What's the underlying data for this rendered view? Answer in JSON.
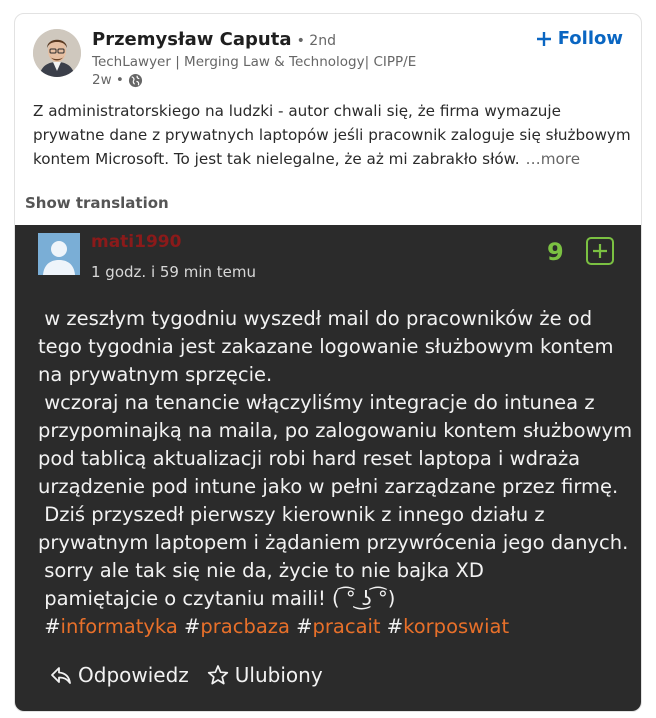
{
  "author": {
    "name": "Przemysław Caputa",
    "degree": "• 2nd",
    "headline": "TechLawyer | Merging Law & Technology| CIPP/E",
    "time": "2w •"
  },
  "follow_label": "Follow",
  "post": {
    "text": "Z administratorskiego na ludzki - autor chwali się, że firma wymazuje prywatne dane z prywatnych laptopów jeśli pracownik zaloguje się służbowym kontem Microsoft. To jest tak nielegalne, że aż mi zabrakło słów.",
    "more": "…more"
  },
  "show_translation": "Show translation",
  "comment": {
    "username": "mati1990",
    "time": "1 godz. i 59 min temu",
    "score": "9",
    "lines": [
      " w zeszłym tygodniu wyszedł mail do pracowników że od",
      "tego tygodnia jest zakazane logowanie służbowym kontem",
      "na prywatnym sprzęcie.",
      " wczoraj na tenancie włączyliśmy integracje do intunea z",
      "przypominajką na maila, po zalogowaniu kontem służbowym",
      "pod tablicą aktualizacji robi hard reset laptopa i wdraża",
      "urządzenie pod intune jako w pełni zarządzane przez firmę.",
      " Dziś przyszedł pierwszy kierownik z innego działu z",
      "prywatnym laptopem i żądaniem przywrócenia jego danych.",
      " sorry ale tak się nie da, życie to nie bajka XD",
      " pamiętajcie o czytaniu maili! ( ͡° ͜ʖ ͡°)"
    ],
    "hashtags": [
      "informatyka",
      "pracbaza",
      "pracait",
      "korposwiat"
    ],
    "reply_label": "Odpowiedz",
    "favorite_label": "Ulubiony"
  },
  "colors": {
    "accent": "#0a66c2",
    "username": "#8b1a1a",
    "score": "#7bc142",
    "hashtag": "#e8702a",
    "dark_bg": "#2b2b2b"
  }
}
